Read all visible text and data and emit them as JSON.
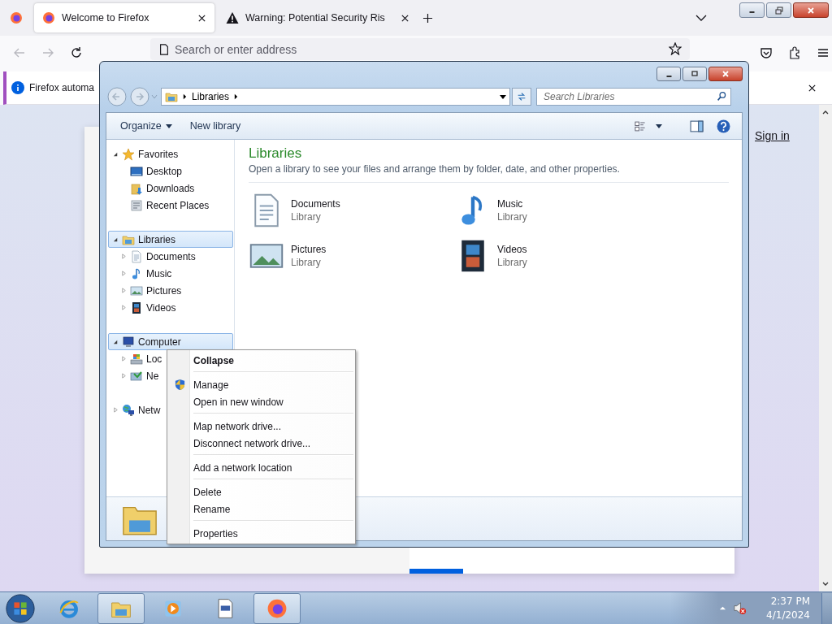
{
  "browser": {
    "tabs": [
      {
        "title": "Welcome to Firefox",
        "kind": "firefox",
        "selected": true
      },
      {
        "title": "Warning: Potential Security Ris",
        "kind": "warning",
        "selected": false
      }
    ],
    "address_placeholder": "Search or enter address",
    "notification": "Firefox automa"
  },
  "page": {
    "sign_in": "Sign in",
    "progress": {
      "level": 0.165
    }
  },
  "explorer": {
    "breadcrumb": [
      "Libraries"
    ],
    "search_placeholder": "Search Libraries",
    "toolbar": [
      {
        "label": "Organize",
        "kind": "menu"
      },
      {
        "label": "New library",
        "kind": "command"
      }
    ],
    "nav": [
      {
        "label": "Favorites",
        "kind": "star",
        "expanded": true,
        "selected": false,
        "children": [
          {
            "label": "Desktop",
            "kind": "desktop",
            "selected": false
          },
          {
            "label": "Downloads",
            "kind": "downloads",
            "selected": false
          },
          {
            "label": "Recent Places",
            "kind": "recent",
            "selected": false
          }
        ]
      },
      {
        "label": "Libraries",
        "kind": "library",
        "expanded": true,
        "selected": true,
        "children": [
          {
            "label": "Documents",
            "kind": "documents",
            "expanded": false,
            "selected": false
          },
          {
            "label": "Music",
            "kind": "music",
            "expanded": false,
            "selected": false
          },
          {
            "label": "Pictures",
            "kind": "pictures",
            "expanded": false,
            "selected": false
          },
          {
            "label": "Videos",
            "kind": "videos",
            "expanded": false,
            "selected": false
          }
        ]
      },
      {
        "label": "Computer",
        "kind": "computer",
        "expanded": true,
        "selected": true,
        "children": [
          {
            "label": "Loc",
            "kind": "disk",
            "expanded": false,
            "selected": false
          },
          {
            "label": "Ne",
            "kind": "netdrive",
            "expanded": false,
            "selected": false
          }
        ]
      },
      {
        "label": "Netw",
        "kind": "network",
        "expanded": false,
        "selected": false
      }
    ],
    "heading": "Libraries",
    "description": "Open a library to see your files and arrange them by folder, date, and other properties.",
    "libraries": [
      {
        "name": "Documents",
        "type": "Library",
        "kind": "documents"
      },
      {
        "name": "Music",
        "type": "Library",
        "kind": "music"
      },
      {
        "name": "Pictures",
        "type": "Library",
        "kind": "pictures"
      },
      {
        "name": "Videos",
        "type": "Library",
        "kind": "videos"
      }
    ]
  },
  "context_menu": [
    [
      {
        "label": "Collapse",
        "bold": true,
        "kind": "plain"
      }
    ],
    [
      {
        "label": "Manage",
        "bold": false,
        "kind": "shield"
      },
      {
        "label": "Open in new window",
        "bold": false,
        "kind": "plain"
      }
    ],
    [
      {
        "label": "Map network drive...",
        "bold": false,
        "kind": "plain"
      },
      {
        "label": "Disconnect network drive...",
        "bold": false,
        "kind": "plain"
      }
    ],
    [
      {
        "label": "Add a network location",
        "bold": false,
        "kind": "plain"
      }
    ],
    [
      {
        "label": "Delete",
        "bold": false,
        "kind": "plain"
      },
      {
        "label": "Rename",
        "bold": false,
        "kind": "plain"
      }
    ],
    [
      {
        "label": "Properties",
        "bold": false,
        "kind": "plain"
      }
    ]
  ],
  "taskbar": {
    "items": [
      {
        "kind": "ie",
        "active": false
      },
      {
        "kind": "folder",
        "active": true
      },
      {
        "kind": "media",
        "active": false
      },
      {
        "kind": "document",
        "active": false
      },
      {
        "kind": "firefox",
        "active": true
      }
    ],
    "time": "2:37 PM",
    "date": "4/1/2024"
  }
}
